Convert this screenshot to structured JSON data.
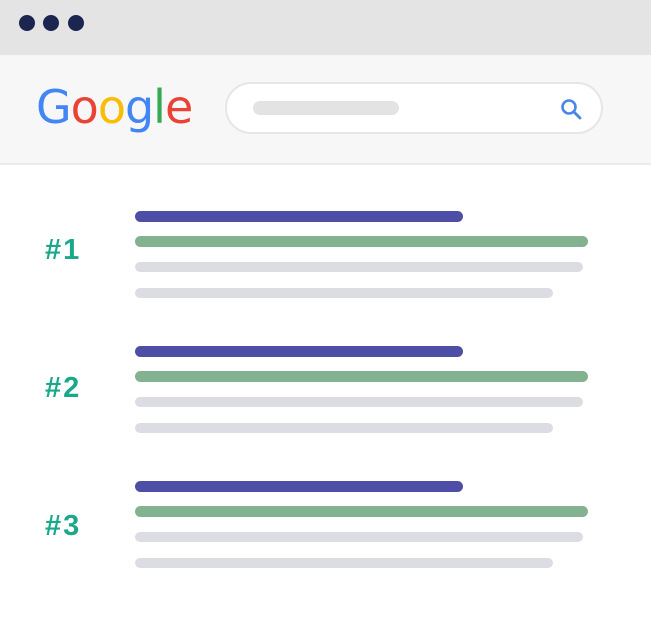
{
  "colors": {
    "titlebar": "#e4e4e4",
    "window_dot": "#1c2450",
    "header_bg": "#f7f7f7",
    "search_placeholder": "#e3e3e3",
    "search_icon": "#4a86e8",
    "rank": "#1aa88b",
    "title_bar": "#4f4ea6",
    "url_bar": "#82b290",
    "snippet_bar": "#dcdde3",
    "google_blue": "#4285f4",
    "google_red": "#ea4335",
    "google_yellow": "#fbbc05",
    "google_green": "#34a853"
  },
  "window": {
    "controls": [
      "window-dot",
      "window-dot",
      "window-dot"
    ]
  },
  "header": {
    "logo_letters": [
      "G",
      "o",
      "o",
      "g",
      "l",
      "e"
    ],
    "search": {
      "icon": "search-icon"
    }
  },
  "results": [
    {
      "rank": "#1"
    },
    {
      "rank": "#2"
    },
    {
      "rank": "#3"
    }
  ]
}
